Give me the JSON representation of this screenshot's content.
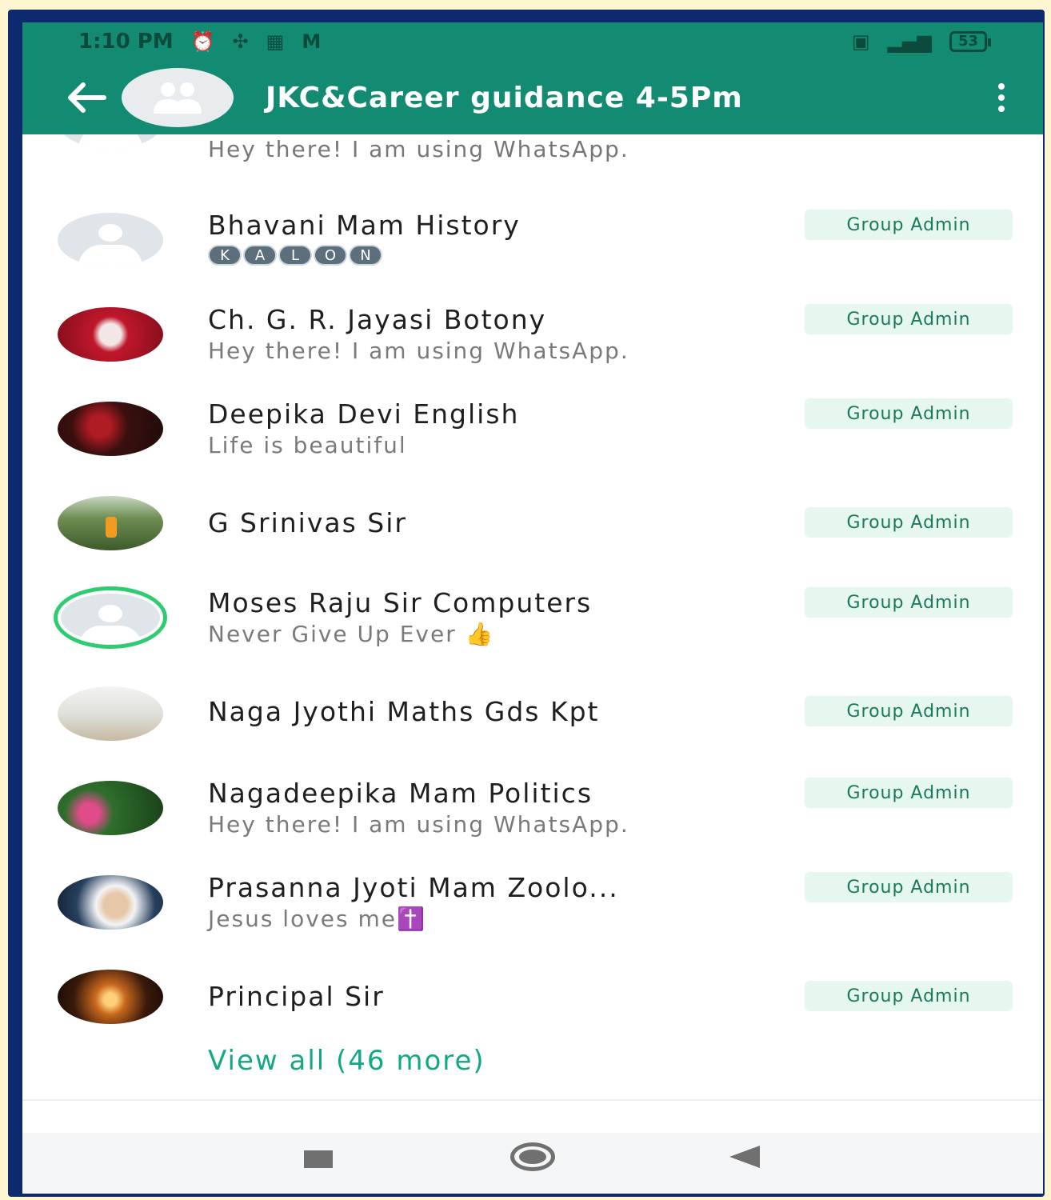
{
  "status_bar": {
    "time": "1:10 PM",
    "battery": "53"
  },
  "header": {
    "title": "JKC&Career guidance 4-5Pm"
  },
  "partial_row": {
    "about": "Hey there! I am using WhatsApp."
  },
  "members": [
    {
      "name": "Bhavani Mam History",
      "about": "",
      "badge": "Group Admin",
      "kalon": [
        "K",
        "A",
        "L",
        "O",
        "N"
      ]
    },
    {
      "name": "Ch. G. R. Jayasi Botony",
      "about": "Hey there! I am using WhatsApp.",
      "badge": "Group Admin"
    },
    {
      "name": "Deepika Devi English",
      "about": "Life is beautiful",
      "badge": "Group Admin"
    },
    {
      "name": "G Srinivas Sir",
      "about": "",
      "badge": "Group Admin"
    },
    {
      "name": "Moses Raju Sir Computers",
      "about": "Never Give Up Ever 👍",
      "badge": "Group Admin"
    },
    {
      "name": "Naga Jyothi Maths Gds Kpt",
      "about": "",
      "badge": "Group Admin"
    },
    {
      "name": "Nagadeepika Mam Politics",
      "about": "Hey there! I am using WhatsApp.",
      "badge": "Group Admin"
    },
    {
      "name": "Prasanna Jyoti Mam Zoolo...",
      "about": "Jesus loves me✝️",
      "badge": "Group Admin"
    },
    {
      "name": "Principal Sir",
      "about": "",
      "badge": "Group Admin"
    }
  ],
  "view_all": "View all (46 more)",
  "icons": {
    "back": "arrow-left-icon",
    "group_avatar": "group-icon",
    "menu": "more-vert-icon",
    "nav_recents": "square-icon",
    "nav_home": "circle-icon",
    "nav_back": "triangle-back-icon"
  },
  "colors": {
    "appbar": "#138a72",
    "accent": "#13a884",
    "badge_bg": "#e6f7ef",
    "badge_text": "#1b7a56"
  }
}
